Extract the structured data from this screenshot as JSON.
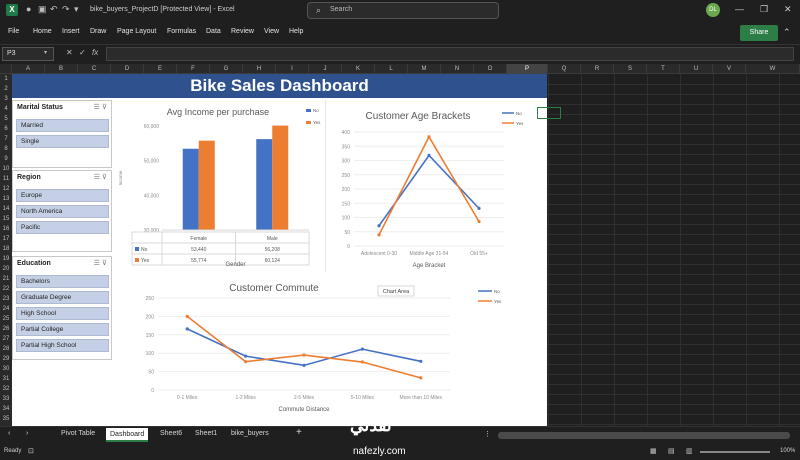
{
  "window": {
    "file_name": "bike_buyers_ProjectD  [Protected View]  - Excel",
    "search_placeholder": "Search",
    "user_initials": "DL"
  },
  "menu": {
    "items": [
      "File",
      "Home",
      "Insert",
      "Draw",
      "Page Layout",
      "Formulas",
      "Data",
      "Review",
      "View",
      "Help"
    ],
    "share_label": "Share"
  },
  "formula_bar": {
    "name_box": "P3",
    "formula": ""
  },
  "columns": [
    "A",
    "B",
    "C",
    "D",
    "E",
    "F",
    "G",
    "H",
    "I",
    "J",
    "K",
    "L",
    "M",
    "N",
    "O",
    "P",
    "Q",
    "R",
    "S",
    "T",
    "U",
    "V",
    "W"
  ],
  "rows": [
    "1",
    "2",
    "3",
    "4",
    "5",
    "6",
    "7",
    "8",
    "9",
    "10",
    "11",
    "12",
    "13",
    "14",
    "15",
    "16",
    "17",
    "18",
    "19",
    "20",
    "21",
    "22",
    "23",
    "24",
    "25",
    "26",
    "27",
    "28",
    "29",
    "30",
    "31",
    "32",
    "33",
    "34",
    "35"
  ],
  "dashboard": {
    "title": "Bike Sales Dashboard"
  },
  "slicers": [
    {
      "title": "Marital Status",
      "items": [
        "Married",
        "Single"
      ]
    },
    {
      "title": "Region",
      "items": [
        "Europe",
        "North America",
        "Pacific"
      ]
    },
    {
      "title": "Education",
      "items": [
        "Bachelors",
        "Graduate Degree",
        "High School",
        "Partial College",
        "Partial High School"
      ]
    }
  ],
  "colors": {
    "no": "#4472c4",
    "yes": "#ed7d31",
    "banner": "#2f528f"
  },
  "chart_data": [
    {
      "type": "bar",
      "title": "Avg Income per purchase",
      "xlabel": "Gender",
      "ylabel": "Income",
      "categories": [
        "Female",
        "Male"
      ],
      "series": [
        {
          "name": "No",
          "values": [
            53440,
            56208
          ],
          "labels": [
            "53,440",
            "56,208"
          ]
        },
        {
          "name": "Yes",
          "values": [
            55774,
            60124
          ],
          "labels": [
            "55,774",
            "60,124"
          ]
        }
      ],
      "ylim": [
        30000,
        60000
      ],
      "ytick_labels": [
        "30,000",
        "40,000",
        "50,000",
        "60,000"
      ],
      "legend": "top-right"
    },
    {
      "type": "line",
      "title": "Customer Age Brackets",
      "xlabel": "Age Bracket",
      "categories": [
        "Adolescent 0-30",
        "Middle Age 31-54",
        "Old 55+"
      ],
      "series": [
        {
          "name": "No",
          "values": [
            71,
            318,
            132
          ]
        },
        {
          "name": "Yes",
          "values": [
            39,
            383,
            86
          ]
        }
      ],
      "ylim": [
        0,
        400
      ],
      "ytick_labels": [
        "0",
        "50",
        "100",
        "150",
        "200",
        "250",
        "300",
        "350",
        "400"
      ],
      "legend": "top-right"
    },
    {
      "type": "line",
      "title": "Customer Commute",
      "xlabel": "Commute Distance",
      "categories": [
        "0-1 Miles",
        "1-2 Miles",
        "2-5 Miles",
        "5-10 Miles",
        "More than 10 Miles"
      ],
      "series": [
        {
          "name": "No",
          "values": [
            166,
            92,
            67,
            111,
            78
          ]
        },
        {
          "name": "Yes",
          "values": [
            200,
            77,
            95,
            76,
            33
          ]
        }
      ],
      "ylim": [
        0,
        250
      ],
      "ytick_labels": [
        "0",
        "50",
        "100",
        "150",
        "200",
        "250"
      ],
      "legend": "top-right",
      "tooltip": "Chart Area"
    }
  ],
  "sheet_tabs": [
    "Pivot Table",
    "Dashboard",
    "Sheet6",
    "Sheet1",
    "bike_buyers"
  ],
  "active_tab": "Dashboard",
  "status": {
    "ready": "Ready",
    "zoom": "100%"
  },
  "watermark": {
    "arabic": "نفذلي",
    "url": "nafezly.com"
  }
}
